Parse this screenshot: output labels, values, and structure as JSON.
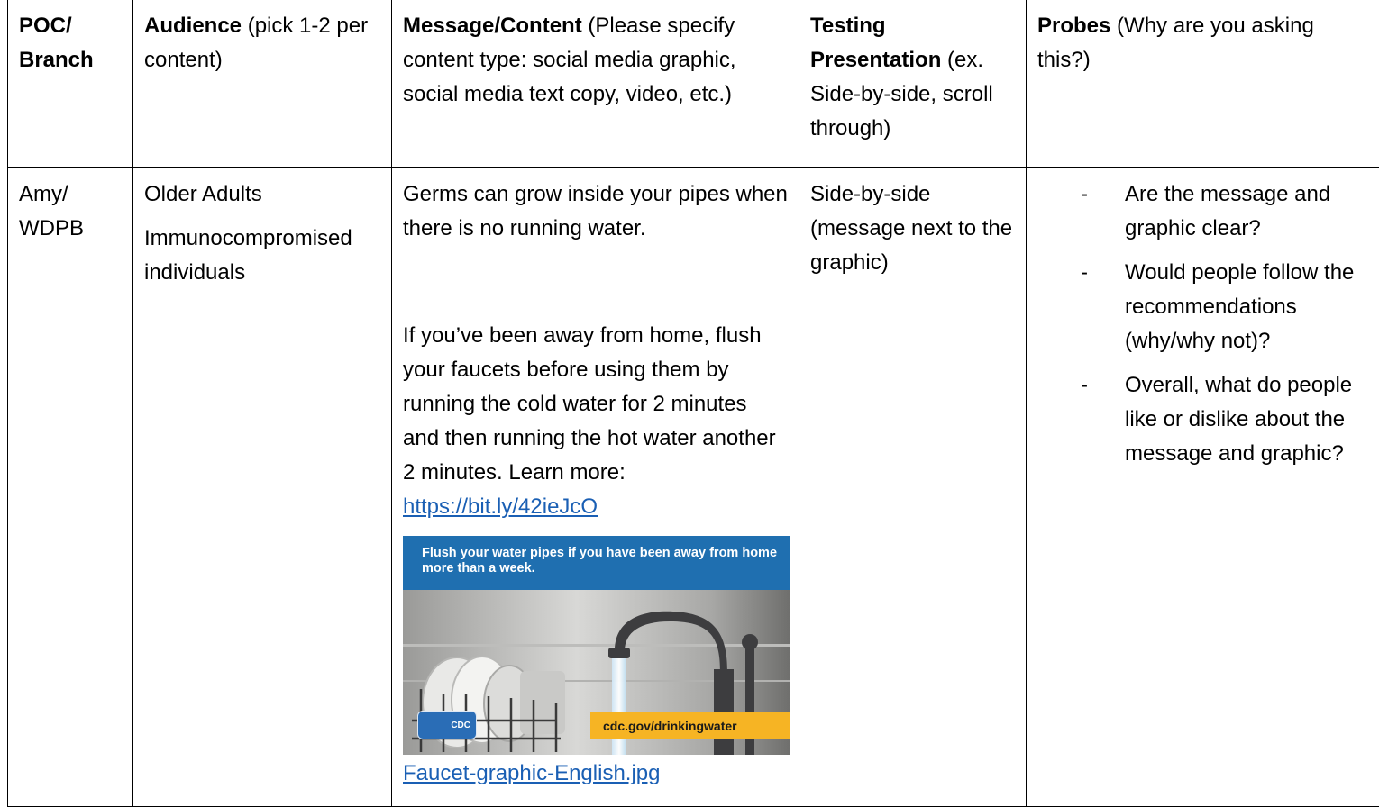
{
  "table": {
    "headers": {
      "poc": {
        "bold": "POC/ Branch",
        "rest": ""
      },
      "audience": {
        "bold": "Audience",
        "rest": " (pick 1-2 per content)"
      },
      "message": {
        "bold": "Message/Content",
        "rest": " (Please specify content type: social media graphic, social media text copy, video, etc.)"
      },
      "testing": {
        "bold": "Testing Presentation",
        "rest": " (ex. Side-by-side, scroll through)"
      },
      "probes": {
        "bold": "Probes",
        "rest": " (Why are you asking this?)"
      }
    },
    "row": {
      "poc": "Amy/ WDPB",
      "audience": [
        "Older Adults",
        "Immunocompromised individuals"
      ],
      "message": {
        "paragraph1": "Germs can grow inside your pipes when there is no running water.",
        "paragraph2": "If you’ve been away from home, flush your faucets before using them by running the cold water for 2 minutes and then running the hot water another 2 minutes. Learn more: ",
        "link": "https://bit.ly/42ieJcO",
        "graphic": {
          "banner_text": "Flush your water pipes if you have been away from home more than a week.",
          "footer_text": "cdc.gov/drinkingwater",
          "badge_text": "CDC",
          "colors": {
            "banner": "#1f6fb0",
            "footer": "#f6b424"
          }
        },
        "file_link": "Faucet-graphic-English.jpg"
      },
      "testing": "Side-by-side (message next to the graphic)",
      "probes": {
        "dash": "-",
        "items": [
          "Are the message and graphic clear?",
          "Would people follow the recommendations (why/why not)?",
          "Overall, what do people like or dislike about the message and graphic?"
        ]
      }
    }
  }
}
